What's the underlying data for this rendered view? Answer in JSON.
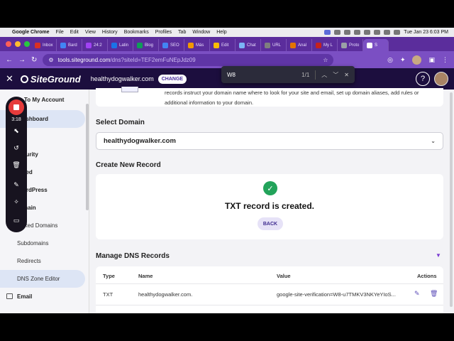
{
  "menubar": {
    "app": "Google Chrome",
    "items": [
      "File",
      "Edit",
      "View",
      "History",
      "Bookmarks",
      "Profiles",
      "Tab",
      "Window",
      "Help"
    ],
    "clock": "Tue Jan 23  6:03 PM"
  },
  "tabs": [
    {
      "label": "Inbox",
      "color": "#d93025"
    },
    {
      "label": "Bard",
      "color": "#4285f4"
    },
    {
      "label": "24:2",
      "color": "#a142f4"
    },
    {
      "label": "Latin",
      "color": "#1a73e8"
    },
    {
      "label": "Blog",
      "color": "#0f9d58"
    },
    {
      "label": "SEO",
      "color": "#4285f4"
    },
    {
      "label": "Más",
      "color": "#f29900"
    },
    {
      "label": "Edit",
      "color": "#fbbc04"
    },
    {
      "label": "Chat",
      "color": "#7bb4f5"
    },
    {
      "label": "URL",
      "color": "#7f7f7f"
    },
    {
      "label": "Anal",
      "color": "#e37400"
    },
    {
      "label": "My L",
      "color": "#c5221f"
    },
    {
      "label": "Proto",
      "color": "#9aa0a6"
    },
    {
      "label": "S",
      "color": "#ffffff"
    }
  ],
  "omnibox": {
    "host": "tools.siteground.com",
    "path": "/dns?siteId=TEF2emFuNEpJdz09"
  },
  "findbar": {
    "query": "W8",
    "count": "1/1"
  },
  "header": {
    "logo": "SiteGround",
    "domain": "healthydogwalker.com",
    "change": "CHANGE",
    "help": "?"
  },
  "recorder": {
    "time": "3:18"
  },
  "sidebar": {
    "items": [
      {
        "label": "To My Account"
      },
      {
        "label": "ashboard"
      },
      {
        "label": "e"
      },
      {
        "label": "curity"
      },
      {
        "label": "eed"
      },
      {
        "label": "ordPress"
      },
      {
        "label": "main"
      },
      {
        "label": "rked Domains"
      },
      {
        "label": "Subdomains"
      },
      {
        "label": "Redirects"
      },
      {
        "label": "DNS Zone Editor"
      },
      {
        "label": "Email"
      }
    ]
  },
  "info": {
    "line1": "records instruct your domain name where to look for your site and email, set up domain aliases, add rules or",
    "line2": "additional information to your domain."
  },
  "select_domain": {
    "title": "Select Domain",
    "value": "healthydogwalker.com"
  },
  "create_record": {
    "title": "Create New Record",
    "message": "TXT record is created.",
    "back": "BACK"
  },
  "manage": {
    "title": "Manage DNS Records",
    "columns": {
      "type": "Type",
      "name": "Name",
      "value": "Value",
      "actions": "Actions"
    },
    "rows": [
      {
        "type": "TXT",
        "name": "healthydogwalker.com.",
        "value": "google-site-verification=W8-u7TMKV3NKYeYIoS..."
      }
    ]
  }
}
